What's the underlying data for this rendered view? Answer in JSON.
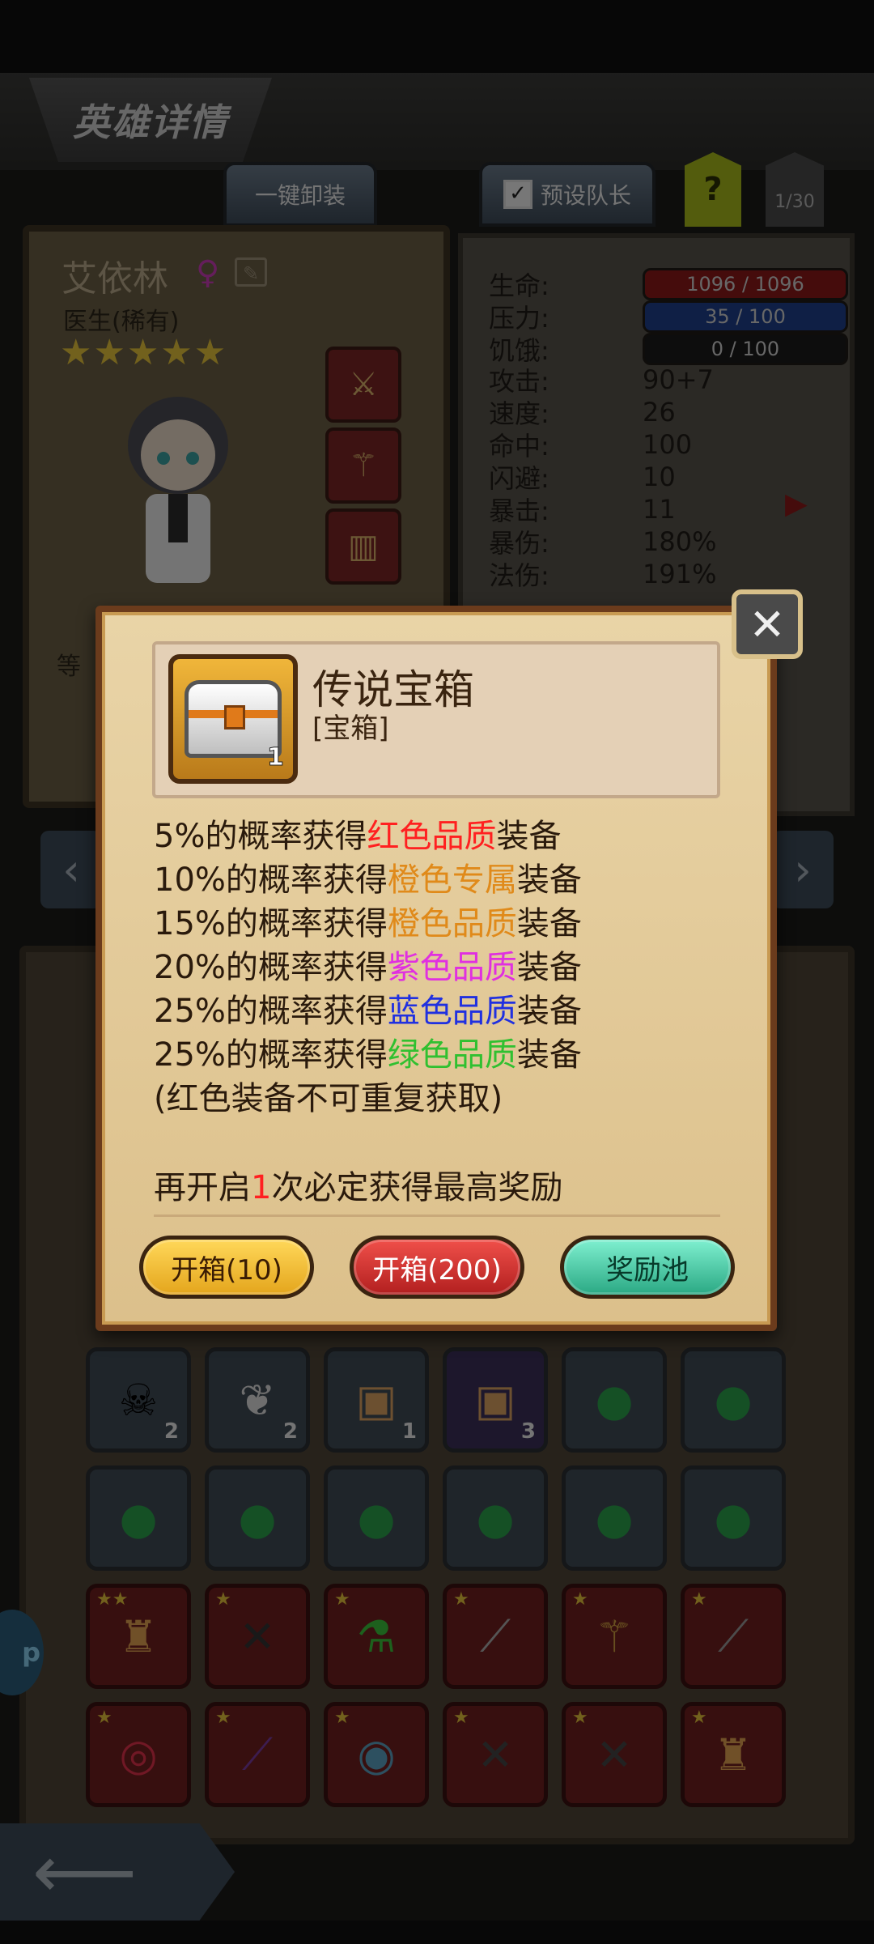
{
  "colors": {
    "red_quality": "#ff2020",
    "orange_quality": "#e08a1a",
    "purple_quality": "#e030e0",
    "blue_quality": "#2030e0",
    "green_quality": "#30c030",
    "hp_bar": "#8a1818",
    "pressure_bar": "#1e3f8a",
    "hunger_bar": "#1a1a1a"
  },
  "header": {
    "title": "英雄详情",
    "unequip_all": "一键卸装",
    "preset_captain": "预设队长",
    "help": "?",
    "page_count": "1/30"
  },
  "hero": {
    "name": "艾依林",
    "gender_icon": "♀",
    "class": "医生(稀有)",
    "stars": "★★★★★",
    "level_label": "等"
  },
  "stats": [
    {
      "label": "生命:",
      "value": "1096 / 1096"
    },
    {
      "label": "压力:",
      "value": "35 / 100"
    },
    {
      "label": "饥饿:",
      "value": "0 / 100"
    },
    {
      "label": "攻击:",
      "value": "90+7"
    },
    {
      "label": "速度:",
      "value": "26"
    },
    {
      "label": "命中:",
      "value": "100"
    },
    {
      "label": "闪避:",
      "value": "10"
    },
    {
      "label": "暴击:",
      "value": "11"
    },
    {
      "label": "暴伤:",
      "value": "180%"
    },
    {
      "label": "法伤:",
      "value": "191%"
    }
  ],
  "dialog": {
    "item_name": "传说宝箱",
    "item_type": "[宝箱]",
    "item_qty": "1",
    "rates": [
      {
        "pre": "5%的概率获得",
        "hl": "红色品质",
        "post": "装备",
        "color": "#ff2020"
      },
      {
        "pre": "10%的概率获得",
        "hl": "橙色专属",
        "post": "装备",
        "color": "#e08a1a"
      },
      {
        "pre": "15%的概率获得",
        "hl": "橙色品质",
        "post": "装备",
        "color": "#e08a1a"
      },
      {
        "pre": "20%的概率获得",
        "hl": "紫色品质",
        "post": "装备",
        "color": "#e030e0"
      },
      {
        "pre": "25%的概率获得",
        "hl": "蓝色品质",
        "post": "装备",
        "color": "#2030e0"
      },
      {
        "pre": "25%的概率获得",
        "hl": "绿色品质",
        "post": "装备",
        "color": "#30c030"
      }
    ],
    "note": "(红色装备不可重复获取)",
    "guarantee_pre": "再开启",
    "guarantee_num": "1",
    "guarantee_post": "次必定获得最高奖励",
    "open10": "开箱(10)",
    "open200": "开箱(200)",
    "reward_pool": "奖励池"
  },
  "inventory": {
    "row1_counts": [
      "2",
      "2",
      "1",
      "3",
      "",
      ""
    ],
    "app_badge": "p"
  }
}
